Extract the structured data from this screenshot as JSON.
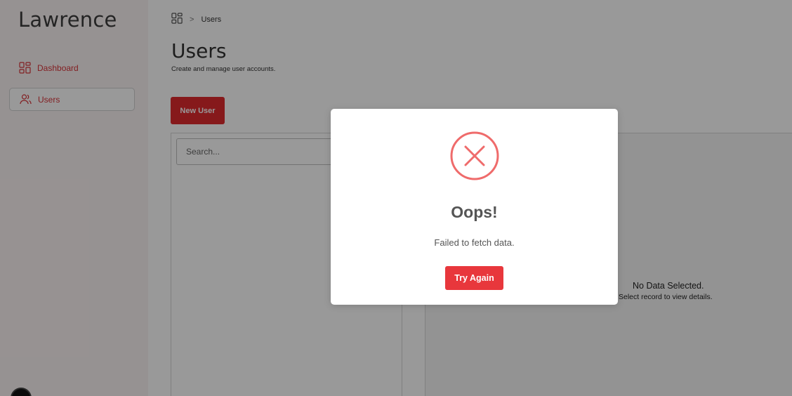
{
  "sidebar": {
    "brand": "Lawrence",
    "items": [
      {
        "label": "Dashboard",
        "icon": "dashboard-grid-icon"
      },
      {
        "label": "Users",
        "icon": "users-icon",
        "active": true
      }
    ]
  },
  "breadcrumb": {
    "home_icon": "dashboard-grid-icon",
    "separator": ">",
    "current": "Users"
  },
  "page": {
    "title": "Users",
    "subtitle": "Create and manage user accounts.",
    "new_user_label": "New User"
  },
  "list": {
    "search_placeholder": "Search..."
  },
  "detail": {
    "empty_title": "No Data Selected.",
    "empty_subtitle": "Select record to view details."
  },
  "modal": {
    "icon": "error-x-icon",
    "title": "Oops!",
    "message": "Failed to fetch data.",
    "button_label": "Try Again"
  },
  "colors": {
    "accent": "#e02a2e",
    "error_icon": "#ef6b6b",
    "sidebar_bg": "#fbf3f3"
  }
}
